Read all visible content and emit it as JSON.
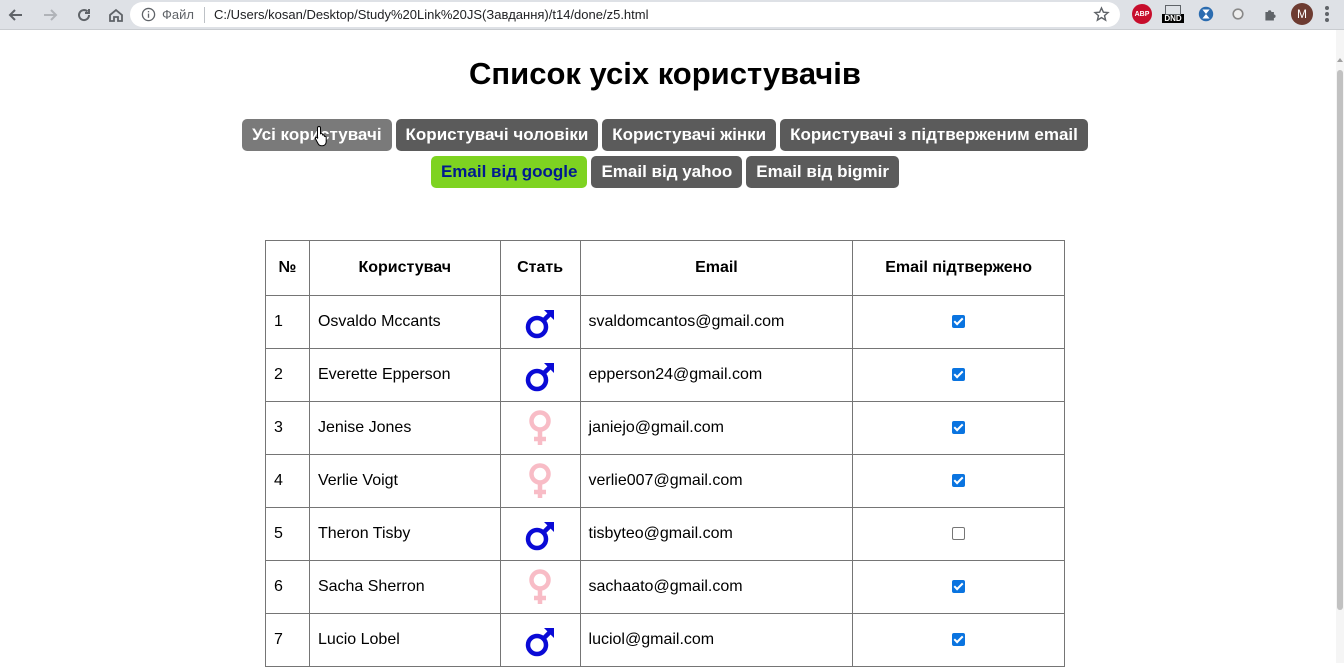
{
  "browser": {
    "omnibox_label": "Файл",
    "url": "C:/Users/kosan/Desktop/Study%20Link%20JS(Завдання)/t14/done/z5.html",
    "extensions": {
      "abp": "ABP",
      "dnd": "DND"
    },
    "avatar_letter": "M"
  },
  "page": {
    "title": "Список усіх користувачів",
    "filters_row1": [
      {
        "label": "Усі користувачі",
        "state": "hover"
      },
      {
        "label": "Користувачі чоловіки",
        "state": "default"
      },
      {
        "label": "Користувачі жінки",
        "state": "default"
      },
      {
        "label": "Користувачі з підтверженим email",
        "state": "default"
      }
    ],
    "filters_row2": [
      {
        "label": "Email від google",
        "state": "active"
      },
      {
        "label": "Email від yahoo",
        "state": "default"
      },
      {
        "label": "Email від bigmir",
        "state": "default"
      }
    ],
    "colors": {
      "active_bg": "#7ed321",
      "active_text": "#001a8f",
      "btn_bg": "#5b5b5b",
      "male": "#0a0ad6",
      "female": "#f8bcc6",
      "checkbox": "#0a74e0"
    }
  },
  "table": {
    "headers": [
      "№",
      "Користувач",
      "Стать",
      "Email",
      "Email підтвержено"
    ],
    "rows": [
      {
        "num": "1",
        "name": "Osvaldo Mccants",
        "sex": "male",
        "email": "svaldomcantos@gmail.com",
        "confirmed": true
      },
      {
        "num": "2",
        "name": "Everette Epperson",
        "sex": "male",
        "email": "epperson24@gmail.com",
        "confirmed": true
      },
      {
        "num": "3",
        "name": "Jenise Jones",
        "sex": "female",
        "email": "janiejo@gmail.com",
        "confirmed": true
      },
      {
        "num": "4",
        "name": "Verlie Voigt",
        "sex": "female",
        "email": "verlie007@gmail.com",
        "confirmed": true
      },
      {
        "num": "5",
        "name": "Theron Tisby",
        "sex": "male",
        "email": "tisbyteo@gmail.com",
        "confirmed": false
      },
      {
        "num": "6",
        "name": "Sacha Sherron",
        "sex": "female",
        "email": "sachaato@gmail.com",
        "confirmed": true
      },
      {
        "num": "7",
        "name": "Lucio Lobel",
        "sex": "male",
        "email": "luciol@gmail.com",
        "confirmed": true
      }
    ]
  }
}
